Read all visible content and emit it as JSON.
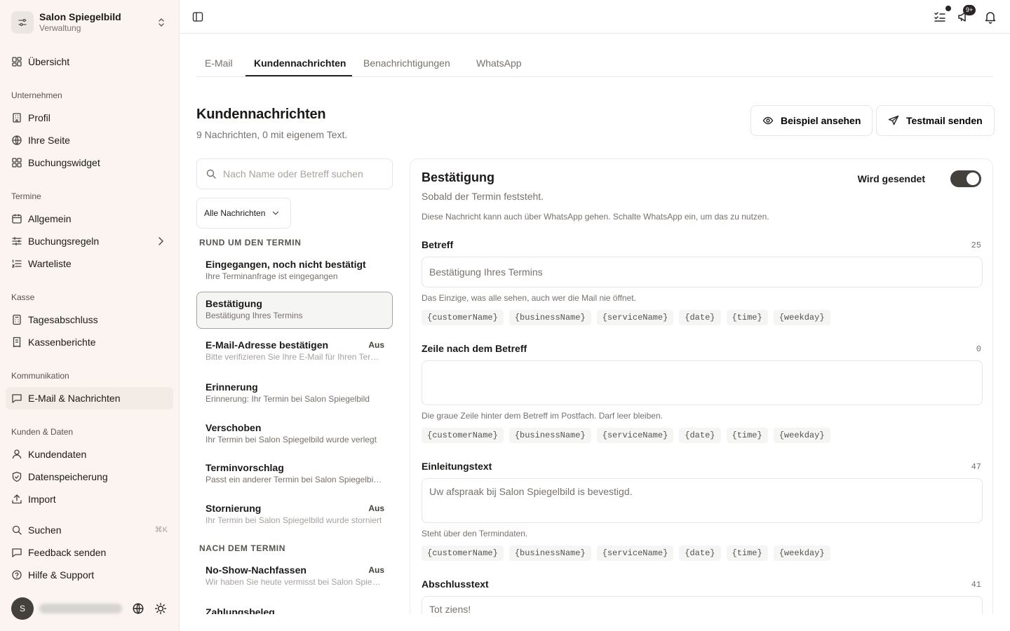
{
  "brand": {
    "name": "Salon Spiegelbild",
    "subtitle": "Verwaltung"
  },
  "sidebar": {
    "overview": "Übersicht",
    "groups": {
      "company": "Unternehmen",
      "appointments": "Termine",
      "cashbox": "Kasse",
      "communication": "Kommunikation",
      "customers": "Kunden & Daten"
    },
    "items": {
      "profile": "Profil",
      "your_page": "Ihre Seite",
      "booking_widget": "Buchungswidget",
      "general": "Allgemein",
      "booking_rules": "Buchungsregeln",
      "waitlist": "Warteliste",
      "daily_close": "Tagesabschluss",
      "cash_reports": "Kassenberichte",
      "email_messages": "E-Mail & Nachrichten",
      "customer_data": "Kundendaten",
      "data_storage": "Datenspeicherung",
      "import": "Import",
      "search": "Suchen",
      "search_shortcut": "⌘K",
      "feedback": "Feedback senden",
      "help": "Hilfe & Support"
    },
    "user": {
      "initial": "S"
    }
  },
  "topbar": {
    "notification_badge": "9+"
  },
  "tabs": [
    "E-Mail",
    "Kundennachrichten",
    "Benachrichtigungen",
    "WhatsApp"
  ],
  "header": {
    "title": "Kundennachrichten",
    "subtitle": "9 Nachrichten, 0 mit eigenem Text.",
    "preview_button": "Beispiel ansehen",
    "testmail_button": "Testmail senden"
  },
  "list": {
    "search_placeholder": "Nach Name oder Betreff suchen",
    "filter_label": "Alle Nachrichten",
    "group_before": "RUND UM DEN TERMIN",
    "group_after": "NACH DEM TERMIN",
    "off_label": "Aus",
    "messages": [
      {
        "title": "Eingegangen, noch nicht bestätigt",
        "subtitle": "Ihre Terminanfrage ist eingegangen",
        "off": false
      },
      {
        "title": "Bestätigung",
        "subtitle": "Bestätigung Ihres Termins",
        "off": false
      },
      {
        "title": "E-Mail-Adresse bestätigen",
        "subtitle": "Bitte verifizieren Sie Ihre E-Mail für Ihren Termin",
        "off": true
      },
      {
        "title": "Erinnerung",
        "subtitle": "Erinnerung: Ihr Termin bei Salon Spiegelbild",
        "off": false
      },
      {
        "title": "Verschoben",
        "subtitle": "Ihr Termin bei Salon Spiegelbild wurde verlegt",
        "off": false
      },
      {
        "title": "Terminvorschlag",
        "subtitle": "Passt ein anderer Termin bei Salon Spiegelbild?",
        "off": false
      },
      {
        "title": "Stornierung",
        "subtitle": "Ihr Termin bei Salon Spiegelbild wurde storniert",
        "off": true
      },
      {
        "title": "No-Show-Nachfassen",
        "subtitle": "Wir haben Sie heute vermisst bei Salon Spiegelbild",
        "off": true
      },
      {
        "title": "Zahlungsbeleg",
        "subtitle": "",
        "off": false
      }
    ]
  },
  "detail": {
    "title": "Bestätigung",
    "subtitle": "Sobald der Termin feststeht.",
    "note": "Diese Nachricht kann auch über WhatsApp gehen. Schalte WhatsApp ein, um das zu nutzen.",
    "send_label": "Wird gesendet",
    "send_enabled": true,
    "placeholders": [
      "{customerName}",
      "{businessName}",
      "{serviceName}",
      "{date}",
      "{time}",
      "{weekday}"
    ],
    "fields": {
      "subject": {
        "label": "Betreff",
        "count": "25",
        "value": "Bestätigung Ihres Termins",
        "help": "Das Einzige, was alle sehen, auch wer die Mail nie öffnet."
      },
      "preheader": {
        "label": "Zeile nach dem Betreff",
        "count": "0",
        "value": "",
        "help": "Die graue Zeile hinter dem Betreff im Postfach. Darf leer bleiben."
      },
      "intro": {
        "label": "Einleitungstext",
        "count": "47",
        "value": "Uw afspraak bij Salon Spiegelbild is bevestigd.",
        "help": "Steht über den Termindaten."
      },
      "closing": {
        "label": "Abschlusstext",
        "count": "41",
        "value": "Tot ziens!"
      }
    }
  },
  "colors": {
    "sidebar_bg": "#fbf4f1",
    "accent": "#44403c",
    "active_item": "#f3ebe6"
  }
}
